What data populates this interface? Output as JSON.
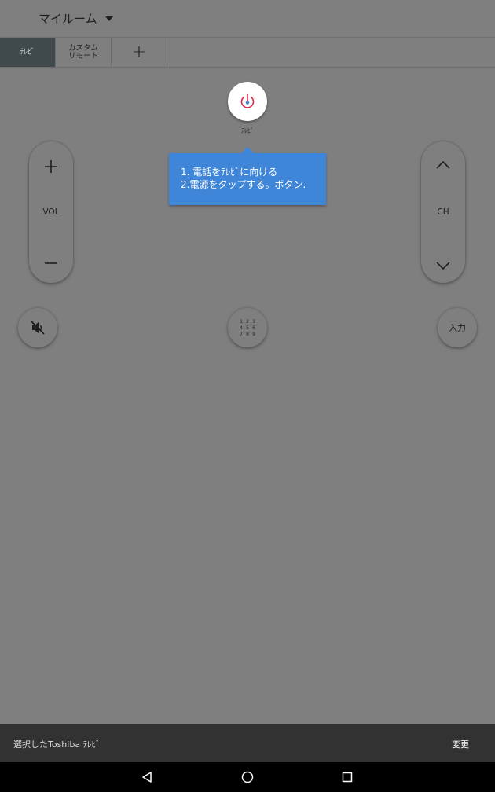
{
  "header": {
    "room_label": "マイルーム"
  },
  "tabs": [
    {
      "label": "ﾃﾚﾋﾞ",
      "active": true
    },
    {
      "label_line1": "カスタム",
      "label_line2": "リモート",
      "active": false
    },
    {
      "label": "+",
      "active": false
    }
  ],
  "power": {
    "label": "ﾃﾚﾋﾞ",
    "icon": "power-icon",
    "icon_color": "#e0284a"
  },
  "tooltip": {
    "line1": "1. 電話をﾃﾚﾋﾞに向ける",
    "line2": "2.電源をタップする。ボタン.",
    "color": "#3f86d8"
  },
  "volume": {
    "label": "VOL",
    "up_icon": "plus-icon",
    "down_icon": "minus-icon"
  },
  "channel": {
    "label": "CH",
    "up_icon": "chevron-up-icon",
    "down_icon": "chevron-down-icon"
  },
  "mute": {
    "icon": "mute-icon"
  },
  "numpad": {
    "digits": [
      "1",
      "2",
      "3",
      "4",
      "5",
      "6",
      "7",
      "8",
      "9"
    ]
  },
  "input_button": {
    "label": "入力"
  },
  "snackbar": {
    "message": "選択したToshiba ﾃﾚﾋﾞ",
    "action": "変更"
  },
  "navigation": {
    "back_icon": "back-icon",
    "home_icon": "home-icon",
    "recents_icon": "recents-icon"
  }
}
